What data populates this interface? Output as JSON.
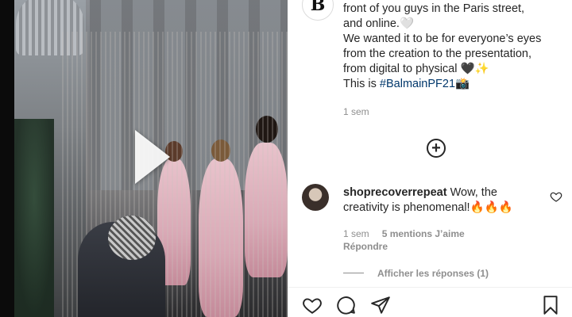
{
  "post": {
    "brand_logo_letter": "B",
    "caption_lines": [
      "front of you guys in the Paris street,",
      "and online.🤍",
      "We wanted it to be for everyone’s eyes",
      "from the creation to the presentation,",
      "from digital to physical 🖤✨",
      "This is "
    ],
    "hashtag": "#BalmainPF21",
    "hashtag_emoji": "📸",
    "time": "1 sem"
  },
  "comment": {
    "username": "shoprecoverrepeat",
    "text": " Wow, the creativity is phenomenal!🔥🔥🔥",
    "time": "1 sem",
    "likes": "5 mentions J’aime",
    "reply": "Répondre",
    "view_replies": "Afficher les réponses (1)"
  },
  "icons": {
    "play": "play-icon",
    "load_more": "plus-circle-icon",
    "heart": "heart-icon",
    "comment": "comment-icon",
    "share": "share-icon",
    "save": "bookmark-icon"
  }
}
